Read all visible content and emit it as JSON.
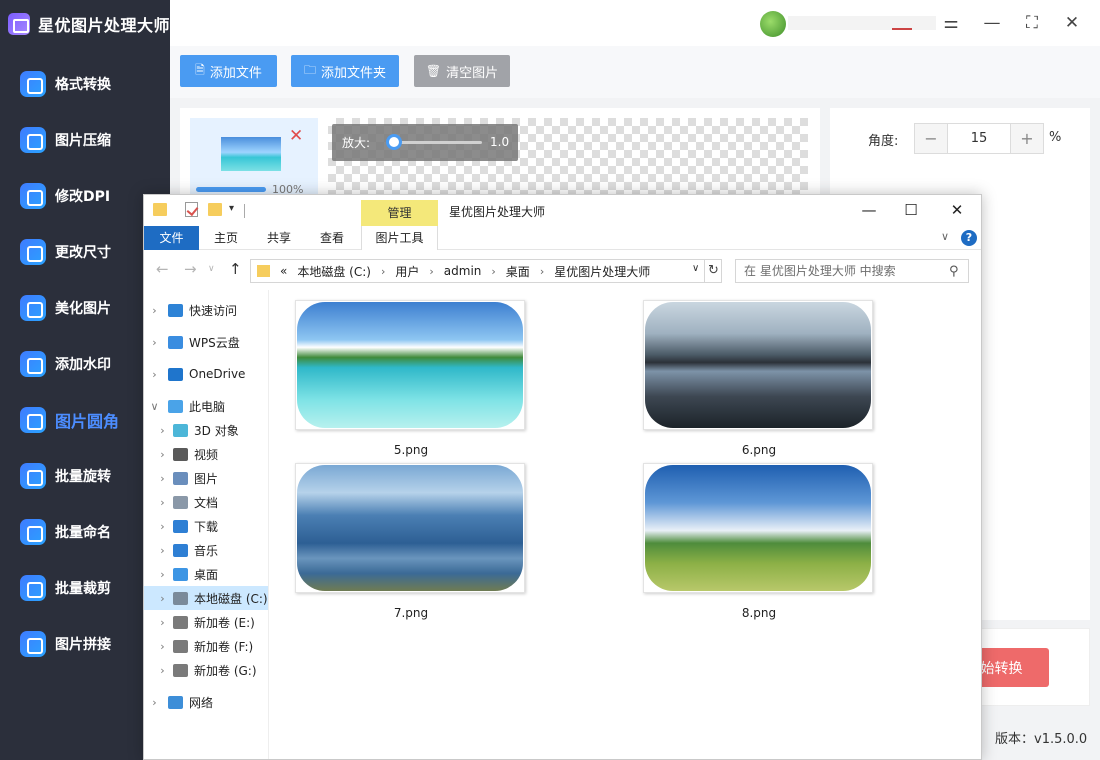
{
  "app": {
    "title": "星优图片处理大师",
    "version": "版本：v1.5.0.0"
  },
  "sidebar": {
    "items": [
      {
        "label": "格式转换",
        "icon": "image-convert-icon",
        "active": false
      },
      {
        "label": "图片压缩",
        "icon": "image-compress-icon",
        "active": false
      },
      {
        "label": "修改DPI",
        "icon": "dpi-icon",
        "active": false
      },
      {
        "label": "更改尺寸",
        "icon": "resize-icon",
        "active": false
      },
      {
        "label": "美化图片",
        "icon": "beautify-icon",
        "active": false
      },
      {
        "label": "添加水印",
        "icon": "watermark-icon",
        "active": false
      },
      {
        "label": "图片圆角",
        "icon": "rounded-corner-icon",
        "active": true
      },
      {
        "label": "批量旋转",
        "icon": "rotate-icon",
        "active": false
      },
      {
        "label": "批量命名",
        "icon": "rename-icon",
        "active": false
      },
      {
        "label": "批量裁剪",
        "icon": "crop-icon",
        "active": false
      },
      {
        "label": "图片拼接",
        "icon": "stitch-icon",
        "active": false
      }
    ]
  },
  "toolbar": {
    "add_file": "添加文件",
    "add_folder": "添加文件夹",
    "clear": "清空图片"
  },
  "thumbnail": {
    "progress_text": "100%",
    "progress": 1.0
  },
  "preview": {
    "zoom_label": "放大:",
    "zoom_value": "1.0"
  },
  "settings": {
    "angle_label": "角度:",
    "angle_value": "15",
    "angle_unit": "%",
    "start_label": "开始转换"
  },
  "explorer": {
    "title": "星优图片处理大师",
    "manage_tab": "管理",
    "ribbon_tabs": [
      "文件",
      "主页",
      "共享",
      "查看",
      "图片工具"
    ],
    "address": {
      "prefix": "«",
      "parts": [
        "本地磁盘 (C:)",
        "用户",
        "admin",
        "桌面",
        "星优图片处理大师"
      ]
    },
    "search_placeholder": "在 星优图片处理大师 中搜索",
    "nav": [
      {
        "label": "快速访问",
        "icon": "quick-access-icon",
        "level": 0
      },
      {
        "label": "WPS云盘",
        "icon": "wps-cloud-icon",
        "level": 0
      },
      {
        "label": "OneDrive",
        "icon": "onedrive-icon",
        "level": 0
      },
      {
        "label": "此电脑",
        "icon": "this-pc-icon",
        "level": 0,
        "expanded": true
      },
      {
        "label": "3D 对象",
        "icon": "3d-objects-icon",
        "level": 1
      },
      {
        "label": "视频",
        "icon": "videos-icon",
        "level": 1
      },
      {
        "label": "图片",
        "icon": "pictures-icon",
        "level": 1
      },
      {
        "label": "文档",
        "icon": "documents-icon",
        "level": 1
      },
      {
        "label": "下载",
        "icon": "downloads-icon",
        "level": 1
      },
      {
        "label": "音乐",
        "icon": "music-icon",
        "level": 1
      },
      {
        "label": "桌面",
        "icon": "desktop-icon",
        "level": 1
      },
      {
        "label": "本地磁盘 (C:)",
        "icon": "drive-c-icon",
        "level": 1,
        "selected": true
      },
      {
        "label": "新加卷 (E:)",
        "icon": "drive-icon",
        "level": 1
      },
      {
        "label": "新加卷 (F:)",
        "icon": "drive-icon",
        "level": 1
      },
      {
        "label": "新加卷 (G:)",
        "icon": "drive-icon",
        "level": 1
      },
      {
        "label": "网络",
        "icon": "network-icon",
        "level": 0
      }
    ],
    "files": [
      {
        "name": "5.png",
        "scene": "tropical-beach"
      },
      {
        "name": "6.png",
        "scene": "mountain-lake"
      },
      {
        "name": "7.png",
        "scene": "blue-mountains"
      },
      {
        "name": "8.png",
        "scene": "tree-on-grassland"
      }
    ]
  },
  "colors": {
    "accent": "#4a9bf2",
    "sidebar_bg": "#2b2f3b",
    "active_nav": "#4c8dff",
    "start_button": "#ee6a6a",
    "clear_button": "#a1a3a8",
    "explorer_file_tab": "#1e6cc3",
    "manage_tab": "#f4e87a"
  }
}
